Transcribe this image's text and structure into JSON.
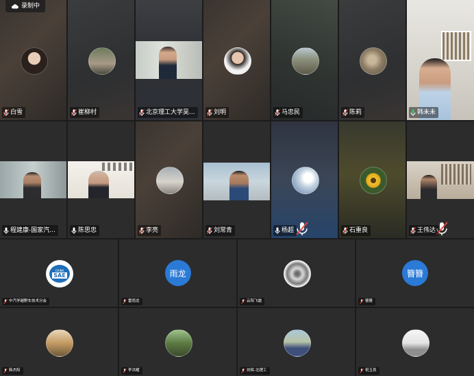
{
  "recording": {
    "label": "录制中"
  },
  "participants_row1": [
    {
      "name": "白雪"
    },
    {
      "name": "崔柳村"
    },
    {
      "name": "北京理工大学吴..."
    },
    {
      "name": "刘明"
    },
    {
      "name": "马忠民"
    },
    {
      "name": "陈莉"
    },
    {
      "name": "韩未未"
    }
  ],
  "participants_row2": [
    {
      "name": "程建康-国家汽..."
    },
    {
      "name": "陈思忠"
    },
    {
      "name": "李亮"
    },
    {
      "name": "刘常青"
    },
    {
      "name": "杨超"
    },
    {
      "name": "石重良"
    },
    {
      "name": "王伟达"
    }
  ],
  "participants_row3": [
    {
      "name": "中汽学越野车技术分会",
      "avatar_text": "SAE",
      "avatar_top": "CHINA"
    },
    {
      "name": "雷雨龙",
      "avatar_text": "雨龙"
    },
    {
      "name": "云阳飞霜"
    },
    {
      "name": "簪簪",
      "avatar_text": "簪簪"
    }
  ],
  "participants_row4": [
    {
      "name": "韩杰阳"
    },
    {
      "name": "李洪耀"
    },
    {
      "name": "刘辉-北理工"
    },
    {
      "name": "祝玉良"
    }
  ],
  "colors": {
    "avatar_blue": "#2a7ad6",
    "mic_green": "#3ec46d",
    "mic_red": "#e0463d"
  }
}
